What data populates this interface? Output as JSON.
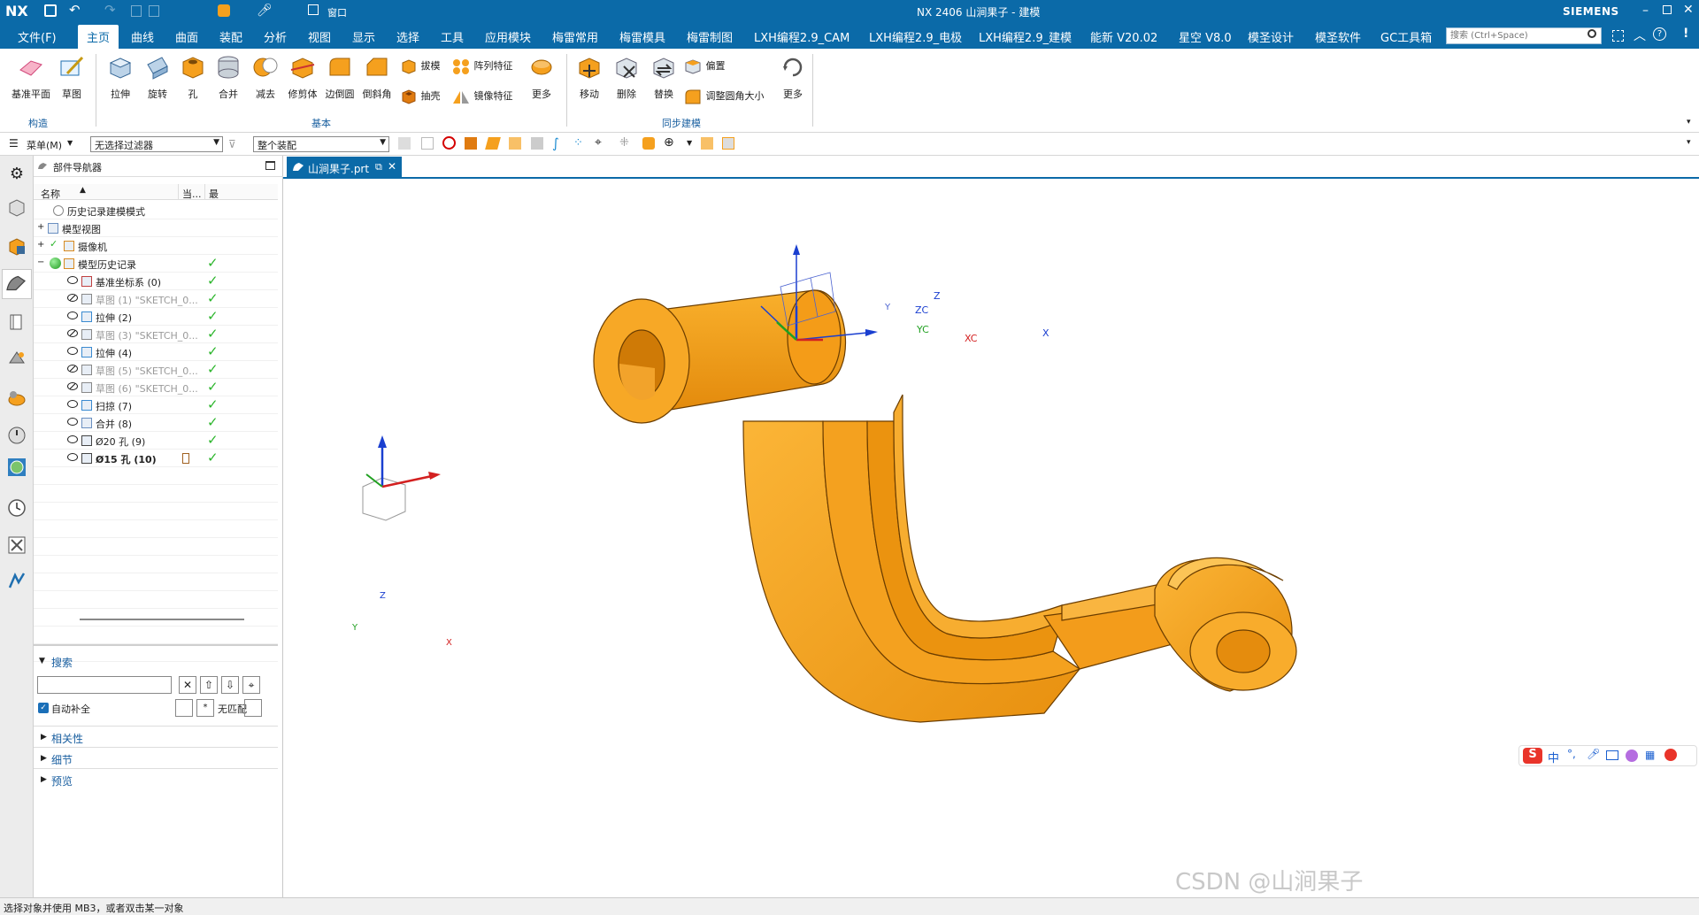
{
  "titlebar": {
    "logo": "NX",
    "title": "NX 2406 山涧果子 - 建模",
    "brand": "SIEMENS",
    "window_label": "窗口"
  },
  "menu": {
    "file": "文件(F)",
    "items": [
      "主页",
      "曲线",
      "曲面",
      "装配",
      "分析",
      "视图",
      "显示",
      "选择",
      "工具",
      "应用模块",
      "梅雷常用",
      "梅雷模具",
      "梅雷制图",
      "LXH编程2.9_CAM",
      "LXH编程2.9_电极",
      "LXH编程2.9_建模",
      "能新 V20.02",
      "星空 V8.0",
      "模圣设计",
      "模圣软件",
      "GC工具箱"
    ],
    "search_placeholder": "搜索 (Ctrl+Space)"
  },
  "ribbon": {
    "construct": {
      "label": "构造",
      "datum_plane": "基准平面",
      "sketch": "草图"
    },
    "basic": {
      "label": "基本",
      "extrude": "拉伸",
      "revolve": "旋转",
      "hole": "孔",
      "unite": "合并",
      "subtract": "减去",
      "trim_body": "修剪体",
      "edge_blend": "边倒圆",
      "chamfer": "倒斜角",
      "draft": "拔模",
      "shell": "抽壳",
      "pattern_feature": "阵列特征",
      "mirror_feature": "镜像特征",
      "more": "更多"
    },
    "sync": {
      "label": "同步建模",
      "move": "移动",
      "delete": "删除",
      "replace": "替换",
      "offset": "偏置",
      "resize_blend": "调整圆角大小",
      "more": "更多"
    }
  },
  "toolbar2": {
    "menu_label": "菜单(M)",
    "filter": "无选择过滤器",
    "scope": "整个装配"
  },
  "navigator": {
    "title": "部件导航器",
    "col_name": "名称",
    "col_current": "当...",
    "col_latest": "最",
    "rows": [
      {
        "label": "历史记录建模模式",
        "dim": false,
        "bold": false,
        "check": false
      },
      {
        "label": "模型视图",
        "dim": false,
        "bold": false,
        "check": false
      },
      {
        "label": "摄像机",
        "dim": false,
        "bold": false,
        "check": false
      },
      {
        "label": "模型历史记录",
        "dim": false,
        "bold": false,
        "check": true
      },
      {
        "label": "基准坐标系 (0)",
        "dim": false,
        "bold": false,
        "check": true
      },
      {
        "label": "草图 (1) \"SKETCH_0...",
        "dim": true,
        "bold": false,
        "check": true
      },
      {
        "label": "拉伸 (2)",
        "dim": false,
        "bold": false,
        "check": true
      },
      {
        "label": "草图 (3) \"SKETCH_0...",
        "dim": true,
        "bold": false,
        "check": true
      },
      {
        "label": "拉伸 (4)",
        "dim": false,
        "bold": false,
        "check": true
      },
      {
        "label": "草图 (5) \"SKETCH_0...",
        "dim": true,
        "bold": false,
        "check": true
      },
      {
        "label": "草图 (6) \"SKETCH_0...",
        "dim": true,
        "bold": false,
        "check": true
      },
      {
        "label": "扫掠 (7)",
        "dim": false,
        "bold": false,
        "check": true
      },
      {
        "label": "合并 (8)",
        "dim": false,
        "bold": false,
        "check": true
      },
      {
        "label": "Ø20 孔 (9)",
        "dim": false,
        "bold": false,
        "check": true
      },
      {
        "label": "Ø15 孔 (10)",
        "dim": false,
        "bold": true,
        "check": true
      }
    ],
    "search": "搜索",
    "autocomplete": "自动补全",
    "no_match": "无匹配",
    "dependencies": "相关性",
    "details": "细节",
    "preview": "预览"
  },
  "tab": {
    "label": "山涧果子.prt"
  },
  "triad": {
    "z": "Z",
    "x": "X",
    "y": "Y",
    "zc": "ZC",
    "yc": "YC",
    "xc": "XC"
  },
  "statusbar": {
    "text": "选择对象并使用 MB3，或者双击某一对象"
  },
  "watermark": "CSDN @山涧果子",
  "colors": {
    "nx_blue": "#0b6aa8",
    "part_orange": "#f5a01e",
    "check_green": "#2bb52b"
  }
}
